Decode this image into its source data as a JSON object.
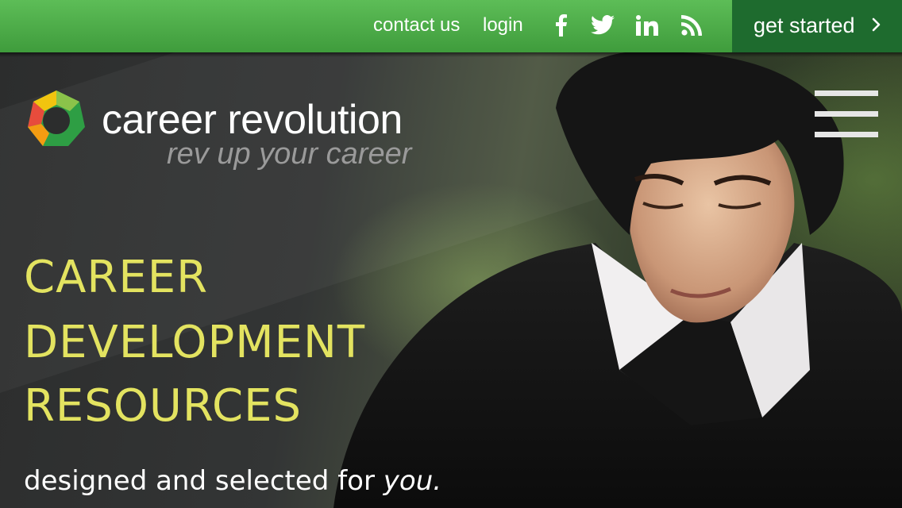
{
  "topbar": {
    "contact_label": "contact us",
    "login_label": "login",
    "social_icons": [
      "facebook-icon",
      "twitter-icon",
      "linkedin-icon",
      "rss-icon"
    ],
    "cta_label": "get started",
    "colors": {
      "bar": "#4fae4a",
      "cta": "#1e6b2e"
    }
  },
  "brand": {
    "name": "career revolution",
    "tagline": "rev up your career",
    "mark_colors": [
      "#e74c3c",
      "#f39c12",
      "#8bc34a",
      "#2e9e44"
    ]
  },
  "hero": {
    "headline_lines": [
      "CAREER",
      "DEVELOPMENT",
      "RESOURCES"
    ],
    "subtitle_prefix": "designed and selected for ",
    "subtitle_emphasis": "you.",
    "headline_color": "#e3e360"
  },
  "menu": {
    "icon": "hamburger-menu-icon"
  }
}
